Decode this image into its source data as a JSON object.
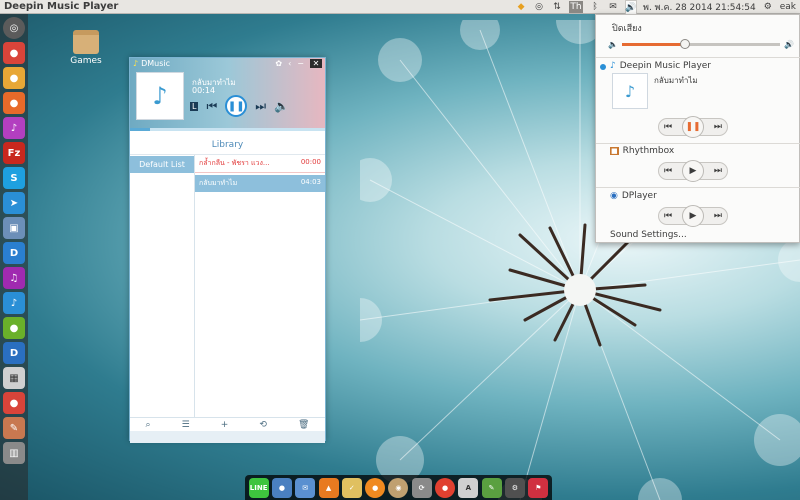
{
  "top_panel": {
    "app_title": "Deepin Music Player",
    "tray_th": "Th",
    "datetime": "พ. พ.ค. 28 2014 21:54:54",
    "user": "eak"
  },
  "desktop": {
    "games_label": "Games"
  },
  "launcher": {
    "items": [
      "launcher",
      "chromium",
      "firefox",
      "podcast",
      "filezilla",
      "skype",
      "telegram",
      "photos",
      "deepin",
      "music",
      "dmusic",
      "green",
      "dplayer",
      "files",
      "recorder",
      "notes",
      "wm"
    ]
  },
  "player": {
    "window_title": "DMusic",
    "current_song": "กลับมาทำไม",
    "current_time": "00:14",
    "library_label": "Library",
    "sidebar_item": "Default List",
    "playlist": [
      {
        "title": "กล้ำกลืน - พัชรา แวง...",
        "duration": "00:00"
      },
      {
        "title": "กลับมาทำไม",
        "duration": "04:03"
      }
    ],
    "progress": 0.1
  },
  "sound_menu": {
    "mute_label": "ปิดเสียง",
    "volume_level": 0.4,
    "players": [
      {
        "name": "Deepin Music Player",
        "track": "กลับมาทำไม",
        "state": "paused"
      },
      {
        "name": "Rhythmbox",
        "state": "stopped"
      },
      {
        "name": "DPlayer",
        "state": "stopped"
      }
    ],
    "settings_label": "Sound Settings..."
  },
  "dock": {
    "items": [
      "line",
      "pidgin",
      "mail",
      "vlc",
      "tasks",
      "orange",
      "disc",
      "sync",
      "chrome",
      "dict",
      "maps",
      "gear",
      "flag"
    ]
  },
  "colors": {
    "accent": "#e66b32",
    "player_blue": "#2a8fd6",
    "playing_red": "#e23b3b"
  }
}
